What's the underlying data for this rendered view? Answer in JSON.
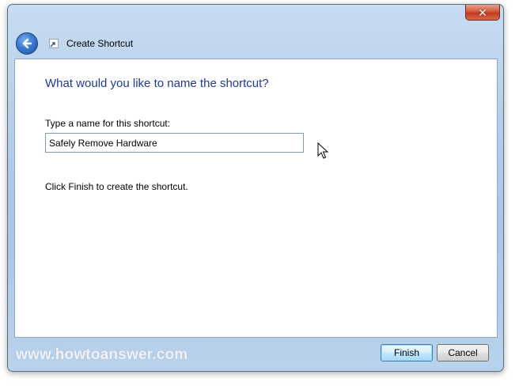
{
  "window": {
    "close_glyph": "✕"
  },
  "header": {
    "title": "Create Shortcut",
    "back_icon": "back-arrow-icon",
    "shortcut_icon": "shortcut-icon"
  },
  "content": {
    "heading": "What would you like to name the shortcut?",
    "name_label": "Type a name for this shortcut:",
    "name_value": "Safely Remove Hardware",
    "finish_note": "Click Finish to create the shortcut."
  },
  "footer": {
    "watermark": "www.howtoanswer.com",
    "finish_label": "Finish",
    "cancel_label": "Cancel"
  },
  "colors": {
    "heading": "#1e3a96",
    "frame": "#b5cfea",
    "close": "#c33a1f"
  }
}
